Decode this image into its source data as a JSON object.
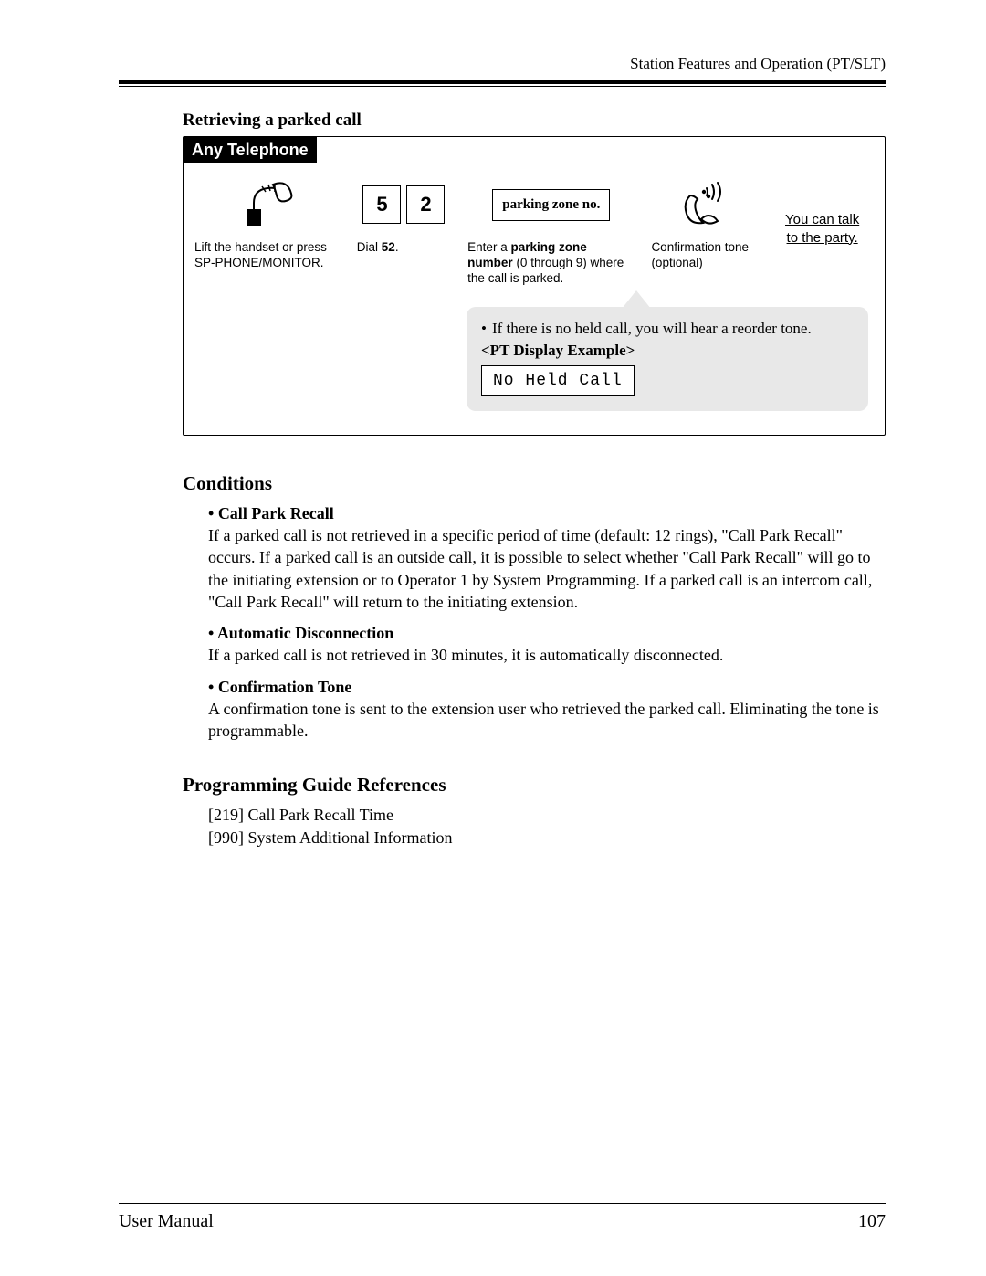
{
  "header": {
    "running": "Station Features and Operation (PT/SLT)"
  },
  "procedure": {
    "title": "Retrieving a parked call",
    "tab": "Any Telephone",
    "steps": {
      "lift": "Lift the handset or press SP-PHONE/MONITOR.",
      "dial_pre": "Dial ",
      "dial_code": "52",
      "dial_post": ".",
      "key1": "5",
      "key2": "2",
      "zone_box": "parking zone no.",
      "zone_cap_pre": "Enter a ",
      "zone_cap_bold": "parking zone number",
      "zone_cap_post": " (0 through 9) where the call is parked.",
      "confirm": "Confirmation tone (optional)",
      "result1": "You can talk",
      "result2": "to the party."
    },
    "callout": {
      "line": "If there is no held call, you will hear a reorder tone.",
      "pt_label": "<PT Display Example>",
      "lcd": "No Held Call"
    }
  },
  "conditions": {
    "heading": "Conditions",
    "items": [
      {
        "title": "Call Park Recall",
        "body": "If a parked call is not retrieved in a specific period of time (default: 12 rings), \"Call Park Recall\" occurs. If a parked call is an outside call, it is possible to select whether \"Call Park Recall\" will go to the initiating extension or to Operator 1 by System Programming. If a parked call is an intercom call, \"Call Park Recall\" will return to the initiating extension."
      },
      {
        "title": "Automatic Disconnection",
        "body": "If a parked call is not retrieved in 30 minutes, it is automatically disconnected."
      },
      {
        "title": "Confirmation Tone",
        "body": "A confirmation tone is sent to the extension user who retrieved the parked call. Eliminating the tone is programmable."
      }
    ]
  },
  "references": {
    "heading": "Programming Guide References",
    "items": [
      "[219] Call Park Recall Time",
      "[990] System Additional Information"
    ]
  },
  "footer": {
    "left": "User Manual",
    "page": "107"
  }
}
